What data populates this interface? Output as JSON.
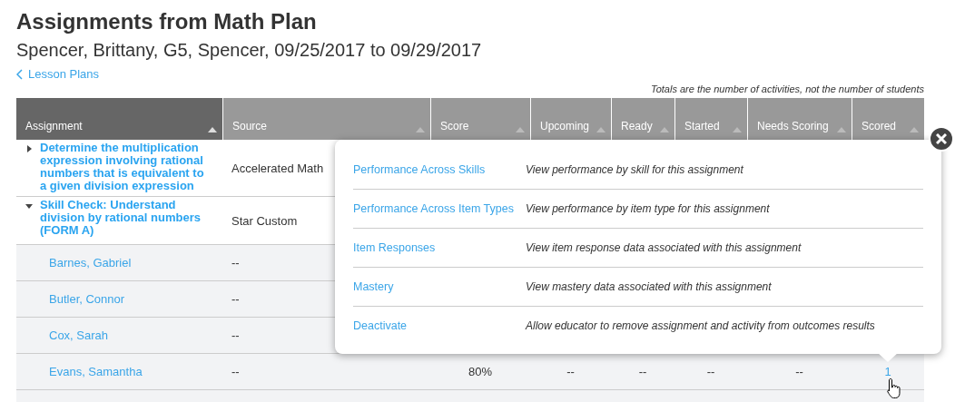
{
  "title": "Assignments from Math Plan",
  "subtitle": "Spencer, Brittany, G5, Spencer, 09/25/2017 to 09/29/2017",
  "back_link": "Lesson Plans",
  "note": "Totals are the number of activities, not the number of students",
  "table": {
    "columns": [
      {
        "label": "Assignment",
        "selected": true
      },
      {
        "label": "Source",
        "selected": false
      },
      {
        "label": "Score",
        "selected": false
      },
      {
        "label": "Upcoming",
        "selected": false
      },
      {
        "label": "Ready",
        "selected": false
      },
      {
        "label": "Started",
        "selected": false
      },
      {
        "label": "Needs Scoring",
        "selected": false
      },
      {
        "label": "Scored",
        "selected": false
      }
    ],
    "rows": [
      {
        "kind": "assignment",
        "name": "Determine the multiplication expression involving rational numbers that is equivalent to a given division expression",
        "source": "Accelerated Math",
        "expanded": false
      },
      {
        "kind": "assignment",
        "name": "Skill Check: Understand division by rational numbers (FORM A)",
        "source": "Star Custom",
        "expanded": true
      },
      {
        "kind": "student",
        "name": "Barnes, Gabriel",
        "source": "--"
      },
      {
        "kind": "student",
        "name": "Butler, Connor",
        "source": "--"
      },
      {
        "kind": "student",
        "name": "Cox, Sarah",
        "source": "--"
      },
      {
        "kind": "student",
        "name": "Evans, Samantha",
        "source": "--",
        "values": [
          "80%",
          "--",
          "--",
          "--",
          "--"
        ],
        "scored": "1"
      }
    ]
  },
  "popover": {
    "items": [
      {
        "link": "Performance Across Skills",
        "description": "View performance by skill for this assignment"
      },
      {
        "link": "Performance Across Item Types",
        "description": "View performance by item type for this assignment"
      },
      {
        "link": "Item Responses",
        "description": "View item response data associated with this assignment"
      },
      {
        "link": "Mastery",
        "description": "View mastery data associated with this assignment"
      },
      {
        "link": "Deactivate",
        "description": "Allow educator to remove assignment and activity from outcomes results"
      }
    ]
  }
}
